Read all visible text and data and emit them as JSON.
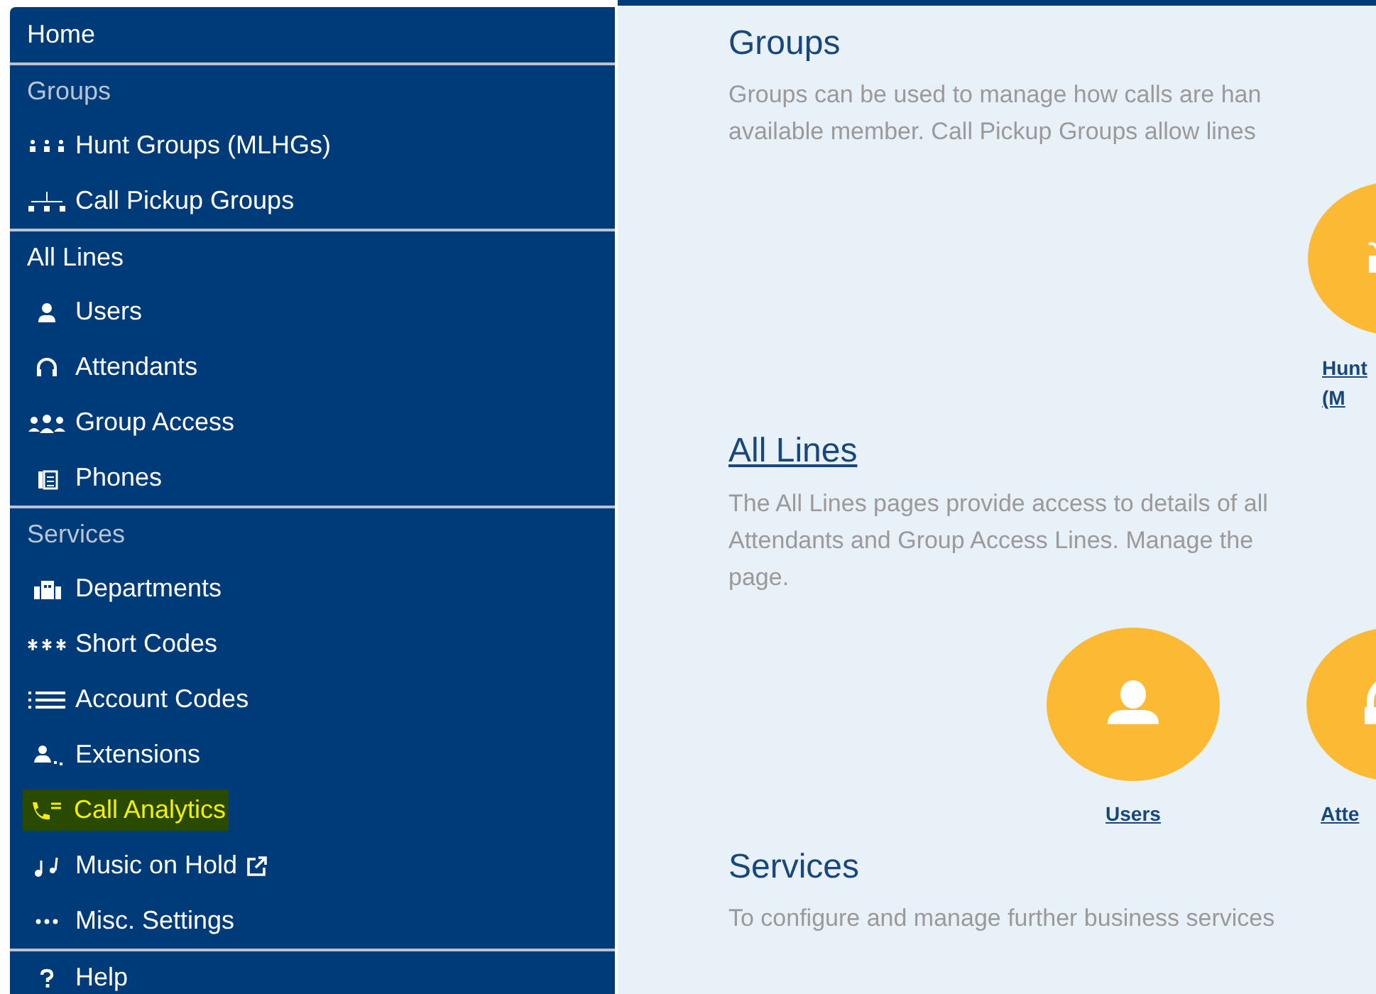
{
  "sidebar": {
    "items": [
      {
        "kind": "header",
        "label": "Home",
        "muted": false
      },
      {
        "kind": "header",
        "label": "Groups",
        "muted": true
      },
      {
        "kind": "link",
        "label": "Hunt Groups (MLHGs)",
        "highlighted": false,
        "external": false
      },
      {
        "kind": "link",
        "label": "Call Pickup Groups",
        "highlighted": false,
        "external": false
      },
      {
        "kind": "header",
        "label": "All Lines",
        "muted": false
      },
      {
        "kind": "link",
        "label": "Users",
        "highlighted": false,
        "external": false
      },
      {
        "kind": "link",
        "label": "Attendants",
        "highlighted": false,
        "external": false
      },
      {
        "kind": "link",
        "label": "Group Access",
        "highlighted": false,
        "external": false
      },
      {
        "kind": "link",
        "label": "Phones",
        "highlighted": false,
        "external": false
      },
      {
        "kind": "header",
        "label": "Services",
        "muted": true
      },
      {
        "kind": "link",
        "label": "Departments",
        "highlighted": false,
        "external": false
      },
      {
        "kind": "link",
        "label": "Short Codes",
        "highlighted": false,
        "external": false
      },
      {
        "kind": "link",
        "label": "Account Codes",
        "highlighted": false,
        "external": false
      },
      {
        "kind": "link",
        "label": "Extensions",
        "highlighted": false,
        "external": false
      },
      {
        "kind": "link",
        "label": "Call Analytics",
        "highlighted": true,
        "external": false
      },
      {
        "kind": "link",
        "label": "Music on Hold",
        "highlighted": false,
        "external": true
      },
      {
        "kind": "link",
        "label": "Misc. Settings",
        "highlighted": false,
        "external": false
      },
      {
        "kind": "header",
        "label": "Help",
        "muted": false
      }
    ]
  },
  "sections": [
    {
      "title": "Groups",
      "title_link": false,
      "description": [
        "Groups can be used to manage how calls are han",
        "available member. Call Pickup Groups allow lines"
      ],
      "tiles": [
        {
          "label": [
            "Hunt",
            "(M"
          ]
        }
      ]
    },
    {
      "title": "All Lines",
      "title_link": true,
      "description": [
        "The All Lines pages provide access to details of all",
        "Attendants and Group Access Lines. Manage the",
        "page."
      ],
      "tiles": [
        {
          "label": [
            "Users"
          ]
        },
        {
          "label": [
            "Atte"
          ]
        }
      ]
    },
    {
      "title": "Services",
      "title_link": false,
      "description": [
        "To configure and manage further business services"
      ]
    }
  ]
}
